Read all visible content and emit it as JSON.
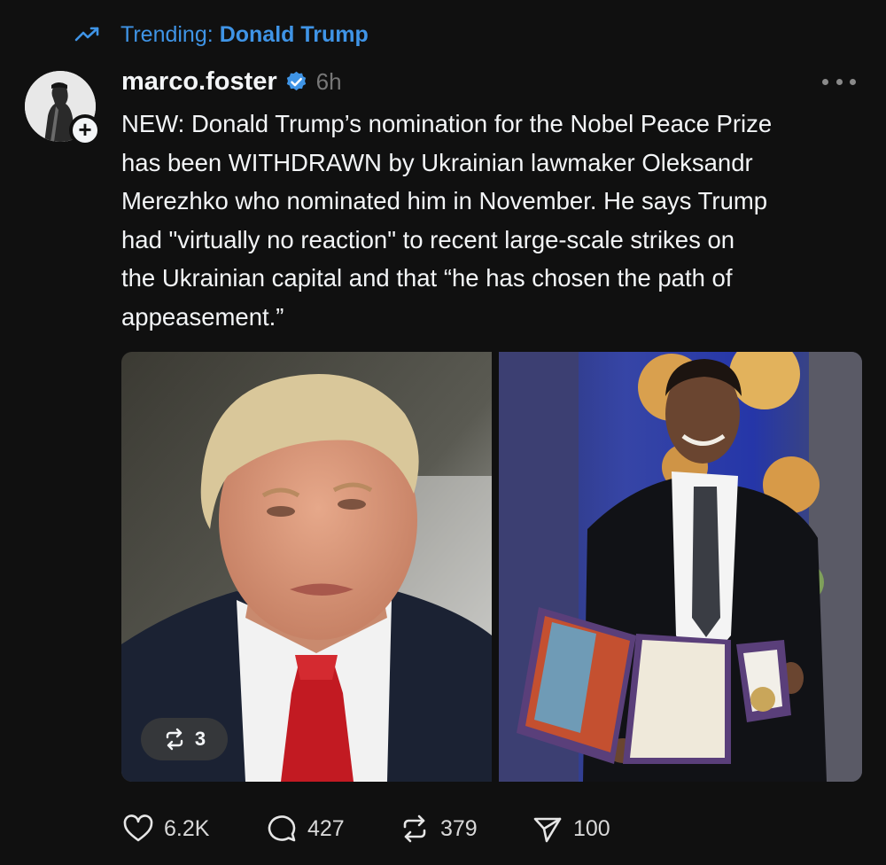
{
  "trending": {
    "icon": "trending-up-icon",
    "label": "Trending:",
    "topic": "Donald Trump"
  },
  "author": {
    "username": "marco.foster",
    "verified_icon": "verified-badge-icon",
    "time": "6h",
    "follow_icon": "plus-icon",
    "follow_symbol": "+"
  },
  "post": {
    "text": "NEW: Donald Trump’s nomination for the Nobel Peace Prize\nhas been WITHDRAWN by Ukrainian lawmaker Oleksandr\nMerezhko who nominated him in November. He says Trump\nhad \"virtually no reaction\" to recent large-scale strikes on\nthe Ukrainian capital and that “he has chosen the path of\nappeasement.”",
    "media_repost_count": "3"
  },
  "actions": {
    "likes": "6.2K",
    "replies": "427",
    "reposts": "379",
    "shares": "100"
  },
  "colors": {
    "background": "#101010",
    "text": "#f3f5f7",
    "accent": "#3f94e6",
    "muted": "#777777"
  }
}
